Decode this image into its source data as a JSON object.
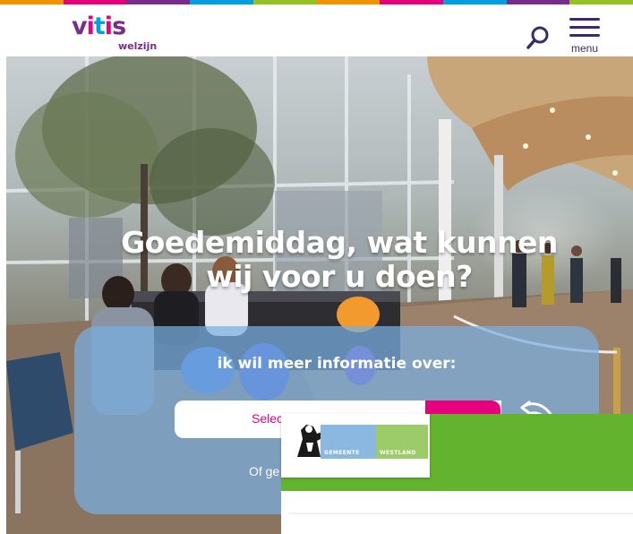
{
  "header": {
    "logo_word": "vitis",
    "logo_sub": "welzijn",
    "search_icon": "search-icon",
    "menu_icon": "hamburger-icon",
    "menu_label": "menu"
  },
  "colors": {
    "brand_purple": "#7a2c8e",
    "brand_pink": "#e6007e",
    "brand_blue": "#009fe3",
    "navy": "#3a2b6b",
    "westland_green": "#64b32e",
    "strip": [
      "#f39200",
      "#e6007e",
      "#7a2c8e",
      "#009fe3",
      "#95c11f",
      "#f39200",
      "#e6007e",
      "#009fe3",
      "#7a2c8e",
      "#95c11f"
    ]
  },
  "hero": {
    "title": "Goedemiddag, wat kunnen wij voor u doen?",
    "panel_label": "ik wil meer informatie over:",
    "select_text": "Selec",
    "other_text": "Of ge"
  },
  "overlay": {
    "logo_left": "GEMEENTE",
    "logo_right": "WESTLAND"
  }
}
